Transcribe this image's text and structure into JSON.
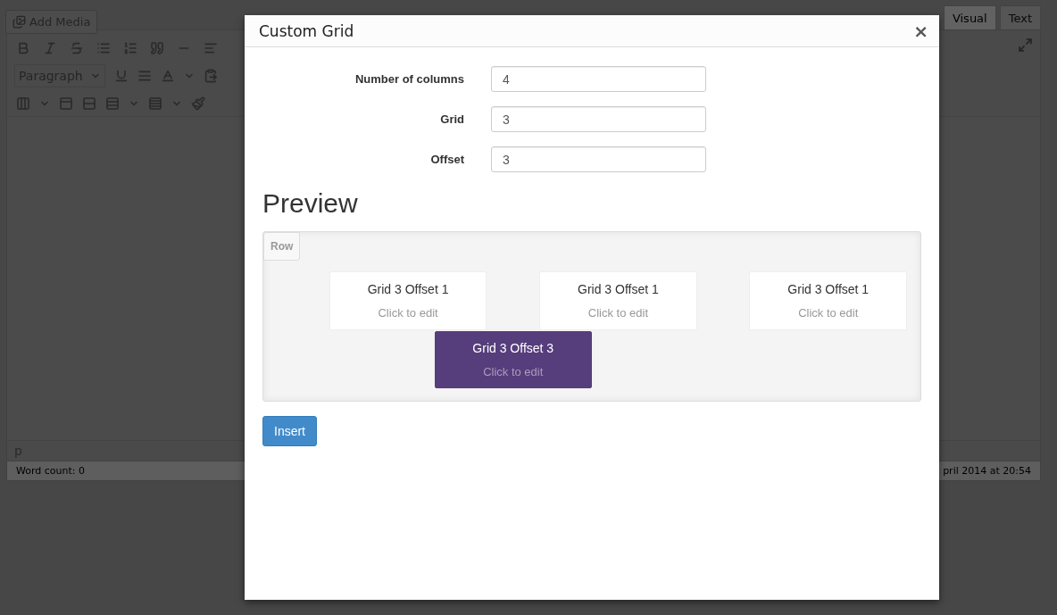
{
  "editor": {
    "add_media": "Add Media",
    "tabs": [
      {
        "label": "Visual",
        "selected": true
      },
      {
        "label": "Text",
        "selected": false
      }
    ],
    "format_select": "Paragraph",
    "path": "p",
    "word_count": "Word count: 0",
    "last_edited": "pril 2014 at 20:54"
  },
  "dialog": {
    "title": "Custom Grid",
    "close": "×",
    "fields": [
      {
        "label": "Number of columns",
        "value": "4"
      },
      {
        "label": "Grid",
        "value": "3"
      },
      {
        "label": "Offset",
        "value": "3"
      }
    ],
    "preview_heading": "Preview",
    "row_label": "Row",
    "cells": [
      {
        "title": "Grid 3 Offset 1",
        "hint": "Click to edit",
        "selected": false
      },
      {
        "title": "Grid 3 Offset 1",
        "hint": "Click to edit",
        "selected": false
      },
      {
        "title": "Grid 3 Offset 1",
        "hint": "Click to edit",
        "selected": false
      },
      {
        "title": "Grid 3 Offset 3",
        "hint": "Click to edit",
        "selected": true
      }
    ],
    "insert": "Insert"
  }
}
